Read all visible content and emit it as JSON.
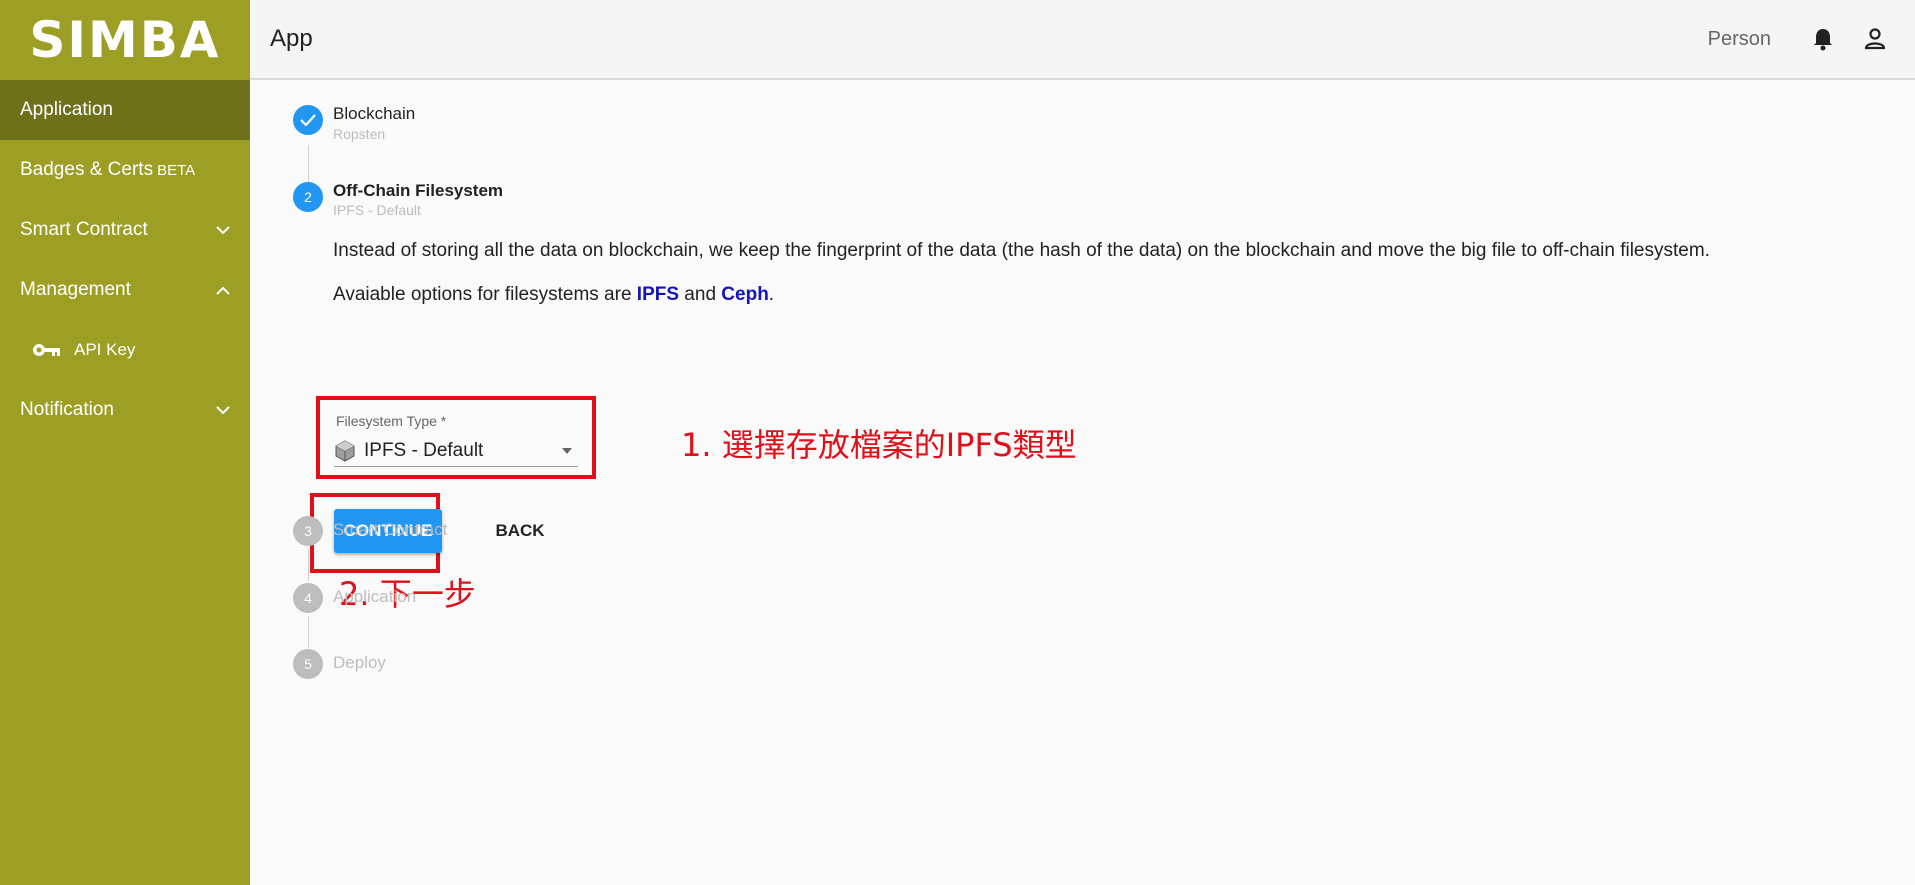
{
  "brand": {
    "logo_text": "SIMBA",
    "color": "#9d9f24",
    "active_color": "#6e701a"
  },
  "sidebar": {
    "items": [
      {
        "label": "Application",
        "active": true
      },
      {
        "label": "Badges & Certs",
        "badge": "BETA"
      },
      {
        "label": "Smart Contract",
        "icon": "chevron-down-icon"
      },
      {
        "label": "Management",
        "icon": "chevron-up-icon"
      },
      {
        "label": "API Key",
        "icon": "key-icon",
        "sub": true
      },
      {
        "label": "Notification",
        "icon": "chevron-down-icon"
      }
    ]
  },
  "header": {
    "title": "App",
    "user_label": "Person",
    "icons": [
      "bell-icon",
      "account-icon"
    ]
  },
  "stepper": {
    "steps": [
      {
        "number": "1",
        "title": "Blockchain",
        "subtitle": "Ropsten",
        "state": "completed"
      },
      {
        "number": "2",
        "title": "Off-Chain Filesystem",
        "subtitle": "IPFS - Default",
        "state": "active"
      },
      {
        "number": "3",
        "title": "Smart Contract",
        "state": "pending"
      },
      {
        "number": "4",
        "title": "Application",
        "state": "pending"
      },
      {
        "number": "5",
        "title": "Deploy",
        "state": "pending"
      }
    ]
  },
  "step2": {
    "description": "Instead of storing all the data on blockchain, we keep the fingerprint of the data (the hash of the data) on the blockchain and move the big file to off-chain filesystem.",
    "options_prefix": "Avaiable options for filesystems are ",
    "option_1": "IPFS",
    "options_and": " and ",
    "option_2": "Ceph",
    "options_suffix": ".",
    "field_label": "Filesystem Type *",
    "field_value": "IPFS - Default",
    "continue_label": "CONTINUE",
    "back_label": "BACK"
  },
  "annotations": {
    "note_1": "1. 選擇存放檔案的IPFS類型",
    "note_2": "2. 下一步",
    "color": "#e0101a"
  }
}
